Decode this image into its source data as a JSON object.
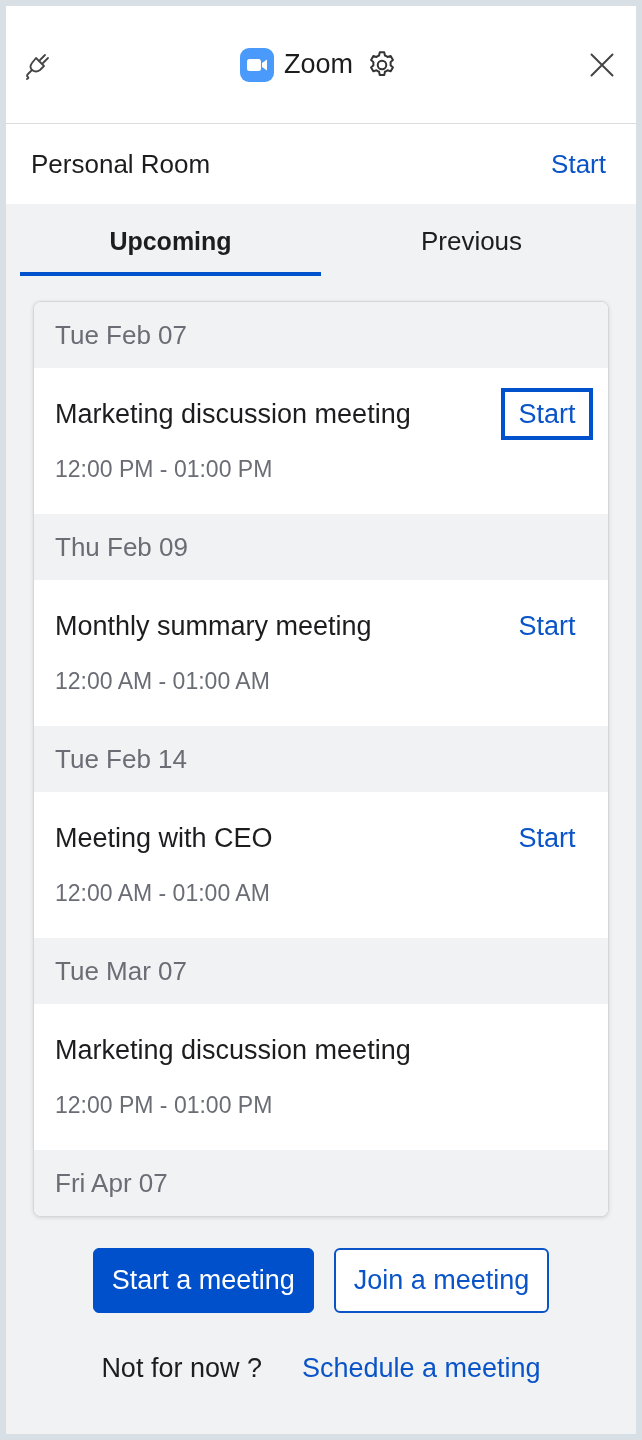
{
  "window": {
    "app_name": "Zoom"
  },
  "personal_room": {
    "label": "Personal Room",
    "action": "Start"
  },
  "tabs": [
    {
      "label": "Upcoming",
      "selected": true
    },
    {
      "label": "Previous",
      "selected": false
    }
  ],
  "groups": [
    {
      "date": "Tue Feb 07",
      "meetings": [
        {
          "title": "Marketing discussion meeting",
          "time": "12:00 PM - 01:00 PM",
          "action": {
            "label": "Start",
            "focused": true
          }
        }
      ]
    },
    {
      "date": "Thu Feb 09",
      "meetings": [
        {
          "title": "Monthly summary meeting",
          "time": "12:00 AM - 01:00 AM",
          "action": {
            "label": "Start",
            "focused": false
          }
        }
      ]
    },
    {
      "date": "Tue Feb 14",
      "meetings": [
        {
          "title": "Meeting with CEO",
          "time": "12:00 AM - 01:00 AM",
          "action": {
            "label": "Start",
            "focused": false
          }
        }
      ]
    },
    {
      "date": "Tue Mar 07",
      "meetings": [
        {
          "title": "Marketing discussion meeting",
          "time": "12:00 PM - 01:00 PM"
        }
      ]
    },
    {
      "date": "Fri Apr 07"
    }
  ],
  "buttons": [
    {
      "label": "Start a meeting",
      "kind": "primary"
    },
    {
      "label": "Join a meeting",
      "kind": "secondary"
    }
  ],
  "footer": {
    "prompt": "Not for now ?",
    "link": "Schedule a meeting"
  }
}
